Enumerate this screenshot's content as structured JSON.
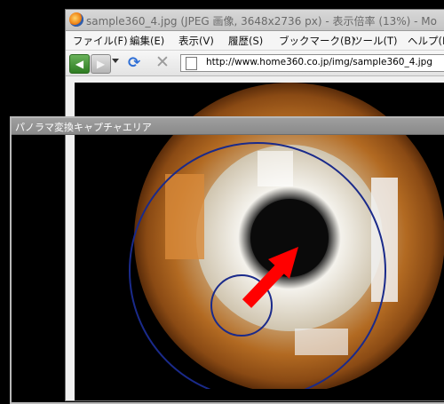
{
  "browser": {
    "title": "sample360_4.jpg (JPEG 画像, 3648x2736 px) - 表示倍率 (13%) - Mo",
    "menu": [
      "ファイル(F)",
      "編集(E)",
      "表示(V)",
      "履歴(S)",
      "ブックマーク(B)",
      "ツール(T)",
      "ヘルプ(H)"
    ],
    "url": "http://www.home360.co.jp/img/sample360_4.jpg"
  },
  "capture_window": {
    "title": "パノラマ変換キャプチャエリア"
  },
  "colors": {
    "circle": "#1a2a8a",
    "arrow": "#ff0000"
  },
  "icons": [
    "firefox-icon",
    "back-icon",
    "forward-icon",
    "reload-icon",
    "stop-icon",
    "page-icon"
  ]
}
